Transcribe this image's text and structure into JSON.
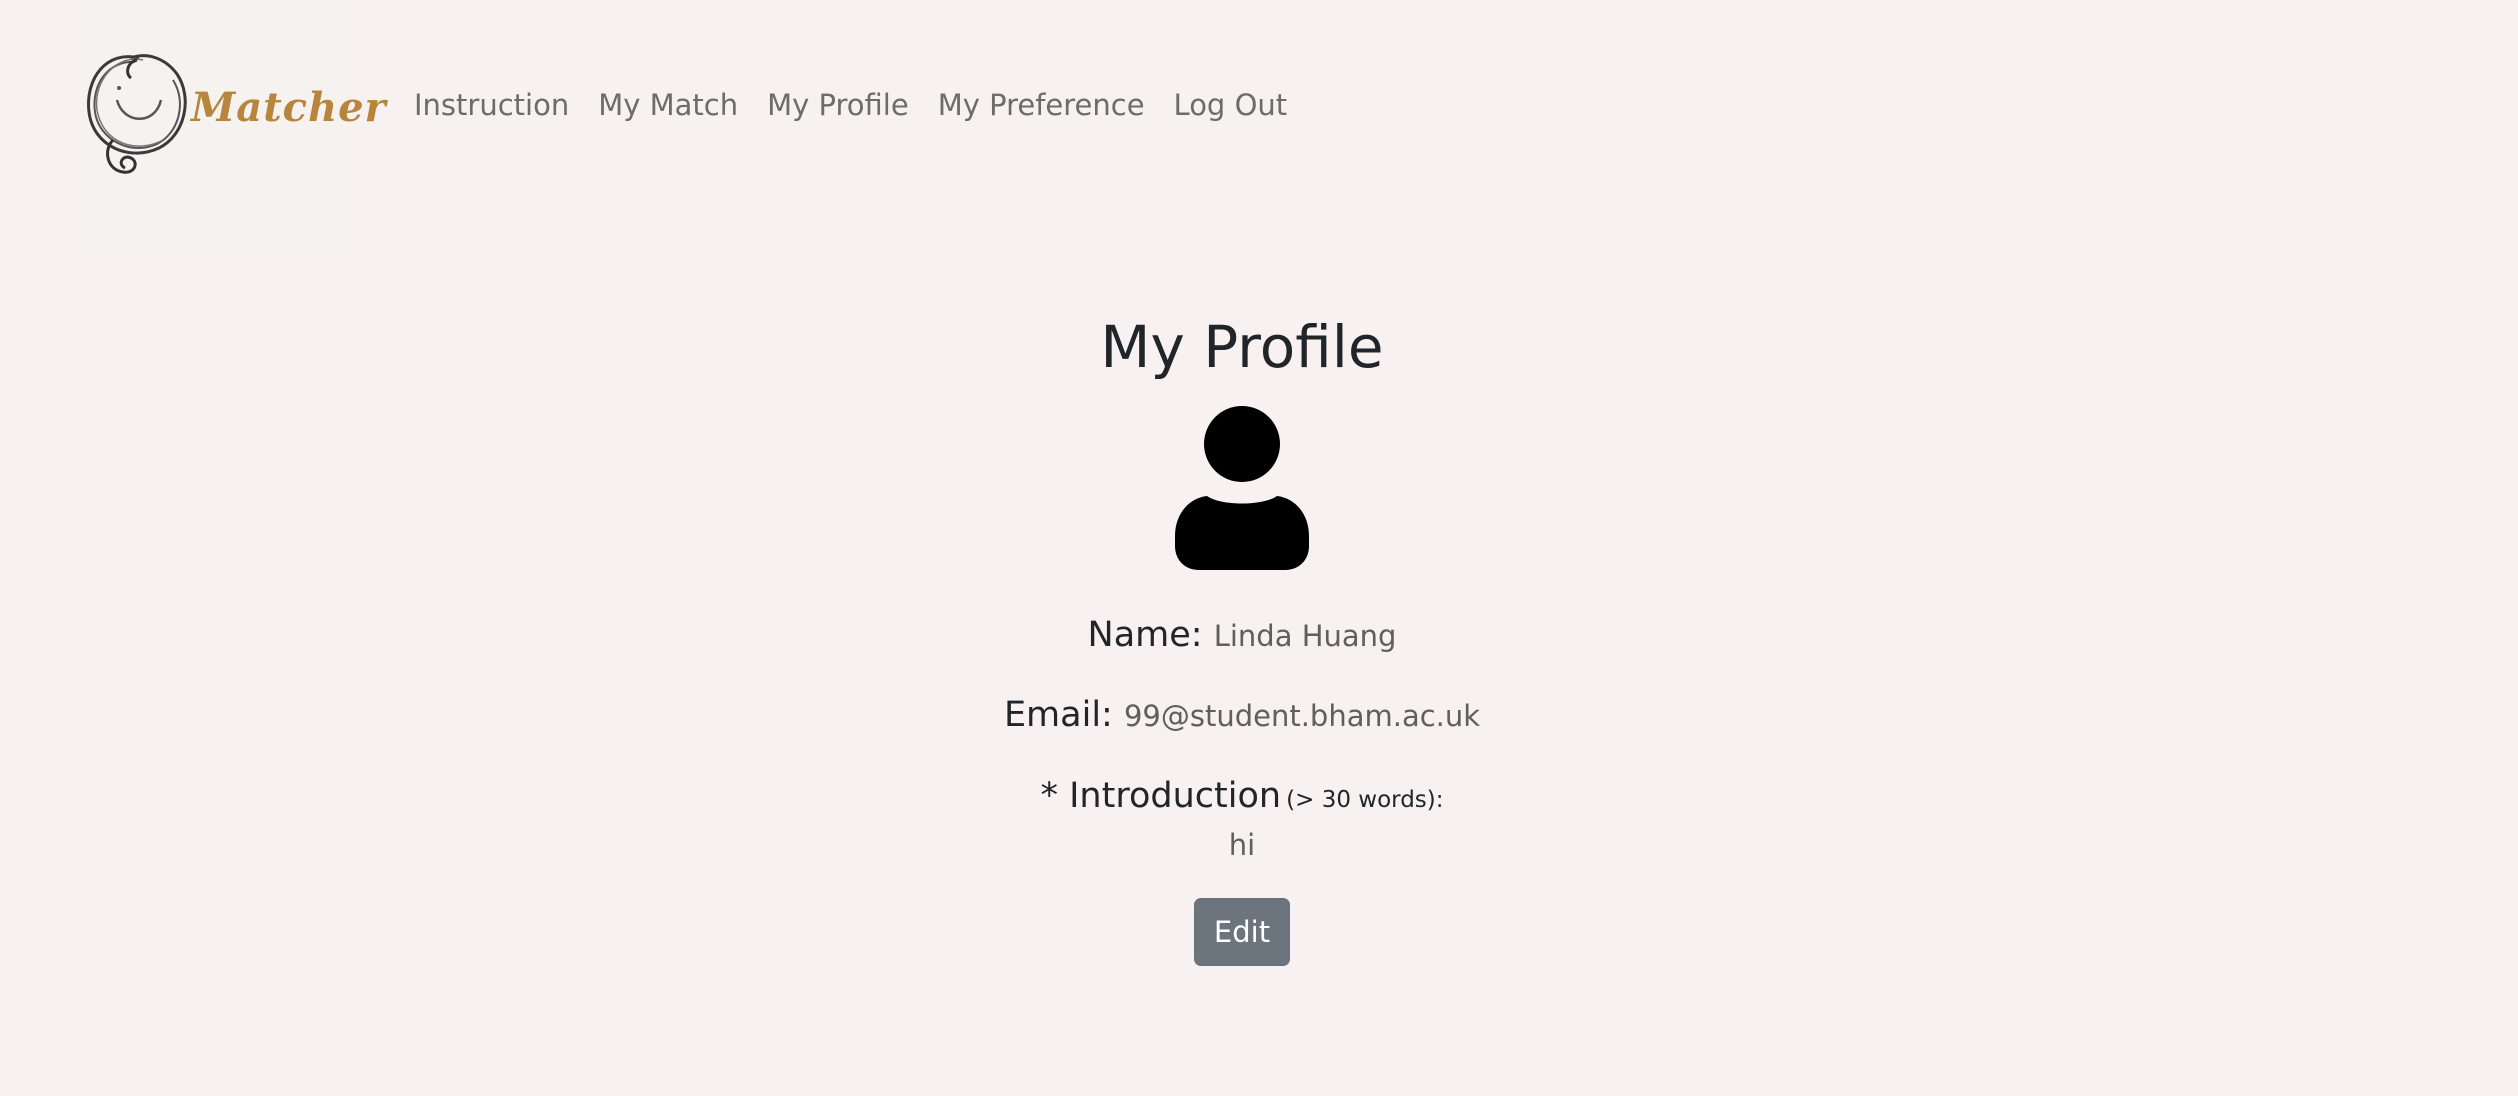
{
  "brand": {
    "logo_icon": "smiley-circle-logo",
    "name": "Matcher",
    "accent_color": "#b7853c"
  },
  "nav": {
    "items": [
      {
        "label": "Instruction"
      },
      {
        "label": "My Match"
      },
      {
        "label": "My Profile"
      },
      {
        "label": "My Preference"
      },
      {
        "label": "Log Out"
      }
    ]
  },
  "profile": {
    "title": "My Profile",
    "avatar_icon": "user-icon",
    "name_label": "Name:",
    "name_value": "Linda Huang",
    "email_label": "Email:",
    "email_value": "99@student.bham.ac.uk",
    "intro_label": "* Introduction",
    "intro_note": "(> 30 words):",
    "intro_value": "hi",
    "edit_label": "Edit"
  },
  "colors": {
    "background": "#f7f1f1",
    "button": "#6c757d"
  }
}
